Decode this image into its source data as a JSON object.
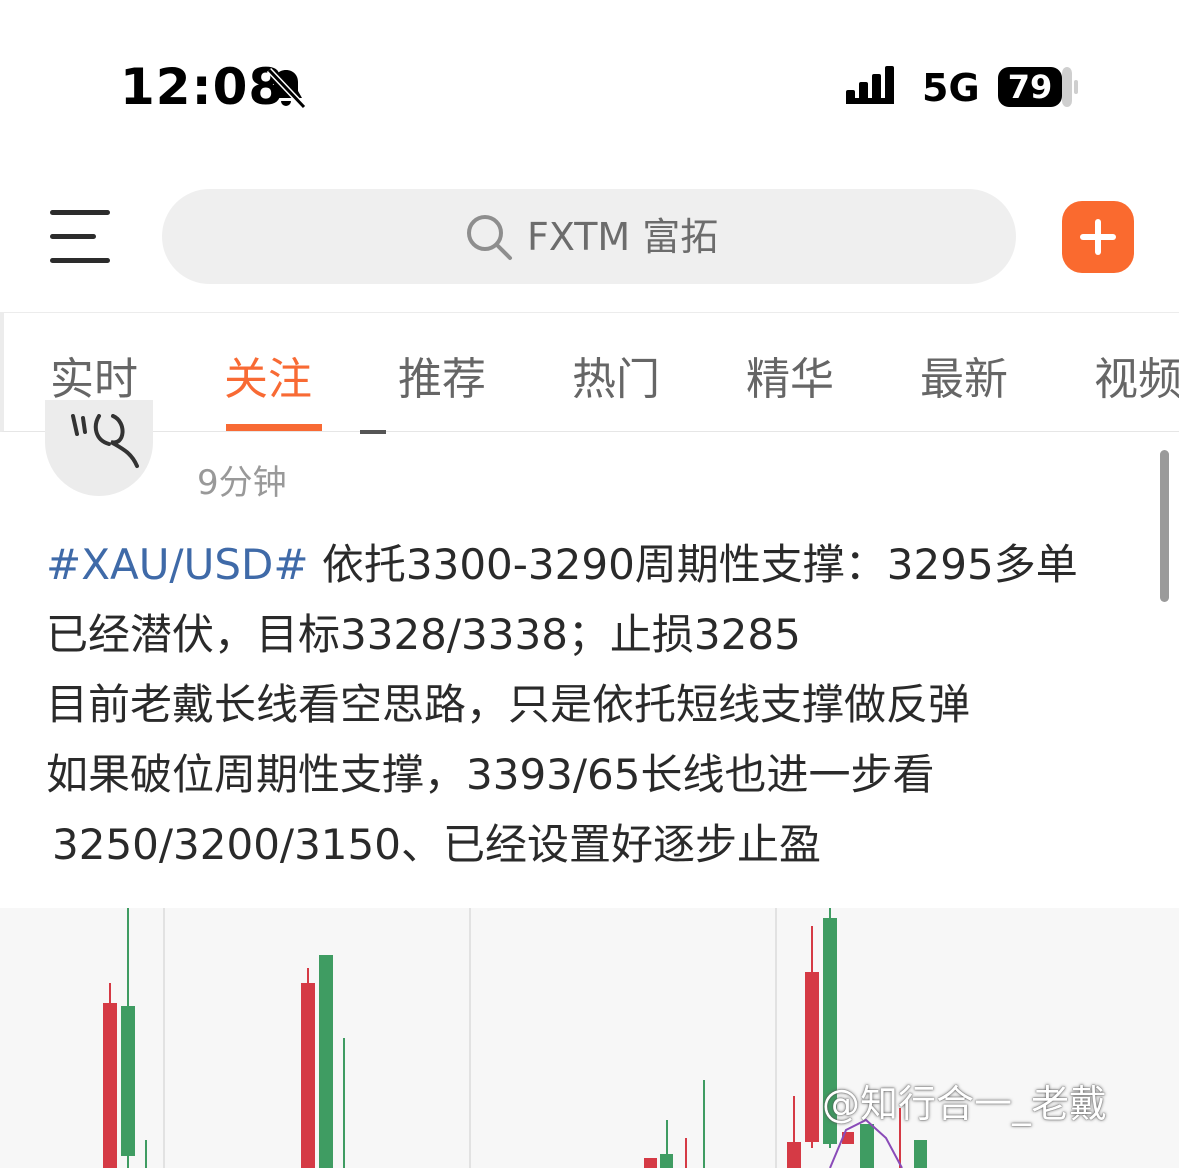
{
  "status_bar": {
    "time": "12:08",
    "network": "5G",
    "battery": "79",
    "icons": [
      "bell-slash-icon",
      "signal-icon",
      "battery-icon"
    ]
  },
  "header": {
    "menu_icon": "hamburger-menu-icon",
    "search_placeholder": "FXTM 富拓",
    "add_icon": "plus-icon",
    "accent_color": "#fa6a2f"
  },
  "tabs": [
    {
      "label": "实时",
      "active": false
    },
    {
      "label": "关注",
      "active": true
    },
    {
      "label": "推荐",
      "active": false
    },
    {
      "label": "热门",
      "active": false
    },
    {
      "label": "精华",
      "active": false
    },
    {
      "label": "最新",
      "active": false
    },
    {
      "label": "视频",
      "active": false
    }
  ],
  "post": {
    "time_ago": "9分钟",
    "hashtag": "#XAU/USD#",
    "lines": [
      " 依托3300-3290周期性支撑：3295多单",
      "已经潜伏，目标3328/3338；止损3285",
      "目前老戴长线看空思路，只是依托短线支撑做反弹",
      "如果破位周期性支撑，3393/65长线也进一步看",
      "3250/3200/3150、已经设置好逐步止盈"
    ],
    "hashtag_color": "#3f6aa8",
    "image_watermark": "@知行合一_老戴"
  },
  "colors": {
    "candle_up": "#3f9c62",
    "candle_down": "#d53a45",
    "indicator_line": "#8a4bb8"
  }
}
